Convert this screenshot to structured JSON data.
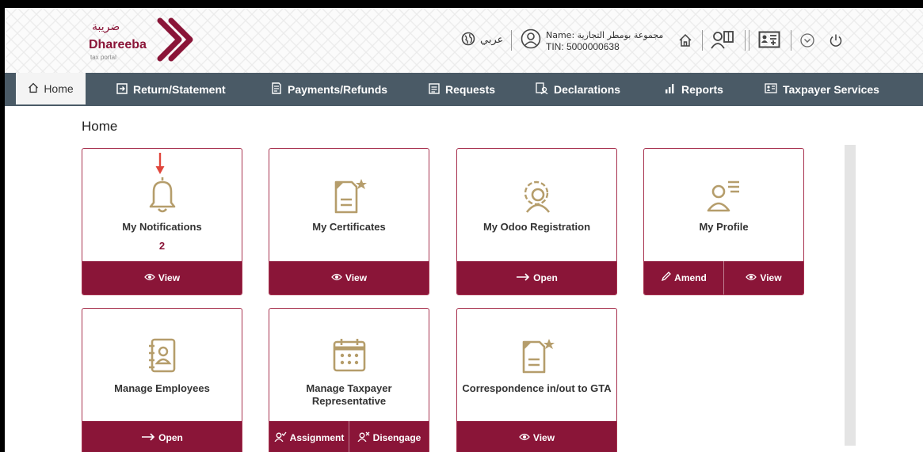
{
  "branding": {
    "arabic_name": "ضريبة",
    "name": "Dhareeba",
    "tagline": "tax portal",
    "color": "#8a1538"
  },
  "header": {
    "language_label": "عربي",
    "user_name": "Name: مجموعة بومطر التجارية",
    "tin": "TIN: 5000000638",
    "icons": [
      "globe-icon",
      "user-circle-icon",
      "home-icon",
      "users-book-icon",
      "id-card-icon",
      "chevron-down-icon",
      "power-icon"
    ]
  },
  "nav": {
    "home": "Home",
    "items": [
      {
        "label": "Return/Statement",
        "icon": "return-icon"
      },
      {
        "label": "Payments/Refunds",
        "icon": "payments-icon"
      },
      {
        "label": "Requests",
        "icon": "requests-icon"
      },
      {
        "label": "Declarations",
        "icon": "declarations-icon"
      },
      {
        "label": "Reports",
        "icon": "reports-icon"
      },
      {
        "label": "Taxpayer Services",
        "icon": "taxpayer-services-icon"
      }
    ]
  },
  "page": {
    "title": "Home"
  },
  "cards": {
    "notifications": {
      "title": "My Notifications",
      "count": "2",
      "actions": [
        "View"
      ]
    },
    "certificates": {
      "title": "My Certificates",
      "actions": [
        "View"
      ]
    },
    "odoo": {
      "title": "My Odoo Registration",
      "actions": [
        "Open"
      ]
    },
    "profile": {
      "title": "My Profile",
      "actions": [
        "Amend",
        "View"
      ]
    },
    "employees": {
      "title": "Manage Employees",
      "actions": [
        "Open"
      ]
    },
    "representative": {
      "title": "Manage Taxpayer Representative",
      "actions": [
        "Assignment",
        "Disengage"
      ]
    },
    "correspondence": {
      "title": "Correspondence in/out to GTA",
      "actions": [
        "View"
      ]
    }
  },
  "colors": {
    "nav_background": "#4a5a66",
    "card_footer": "#8a1538",
    "icon_gold": "#b59d6b",
    "marker_red": "#e0463c"
  }
}
